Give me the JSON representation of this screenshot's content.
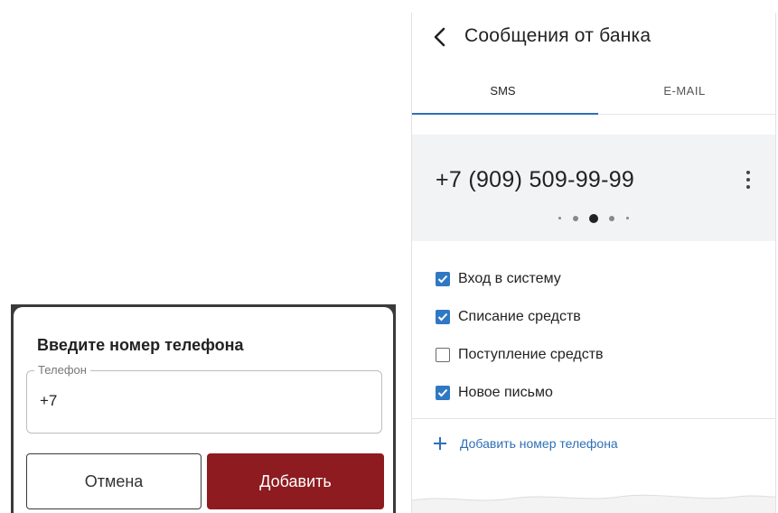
{
  "bank_messages": {
    "title": "Сообщения от банка",
    "tabs": [
      {
        "label": "SMS",
        "active": true
      },
      {
        "label": "E-MAIL",
        "active": false
      }
    ],
    "phone_number": "+7 (909) 509-99-99",
    "notifications": [
      {
        "label": "Вход в систему",
        "checked": true
      },
      {
        "label": "Списание средств",
        "checked": true
      },
      {
        "label": "Поступление средств",
        "checked": false
      },
      {
        "label": "Новое письмо",
        "checked": true
      }
    ],
    "add_phone_label": "Добавить номер телефона",
    "accent_color": "#2f6fb5",
    "icons": [
      "chevron-left-icon",
      "more-vert-icon",
      "plus-icon"
    ]
  },
  "add_phone_dialog": {
    "title": "Введите номер телефона",
    "field_label": "Телефон",
    "field_value": "+7",
    "cancel_label": "Отмена",
    "add_label": "Добавить",
    "add_button_color": "#8e1b1f"
  }
}
